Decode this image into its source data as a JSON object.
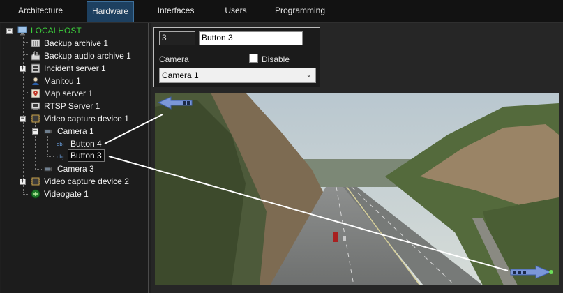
{
  "tabs": [
    {
      "label": "Architecture"
    },
    {
      "label": "Hardware"
    },
    {
      "label": "Interfaces"
    },
    {
      "label": "Users"
    },
    {
      "label": "Programming"
    }
  ],
  "active_tab": "Hardware",
  "tree": {
    "root": "LOCALHOST",
    "items": [
      {
        "label": "Backup archive 1",
        "icon": "backup-archive-icon"
      },
      {
        "label": "Backup audio archive 1",
        "icon": "audio-archive-icon"
      },
      {
        "label": "Incident server 1",
        "icon": "incident-server-icon"
      },
      {
        "label": "Manitou 1",
        "icon": "manitou-icon"
      },
      {
        "label": "Map server 1",
        "icon": "map-server-icon"
      },
      {
        "label": "RTSP Server 1",
        "icon": "rtsp-server-icon"
      },
      {
        "label": "Video capture device 1",
        "icon": "capture-device-icon"
      },
      {
        "label": "Camera 1",
        "icon": "camera-icon"
      },
      {
        "label": "Button 4",
        "icon": "obj-icon"
      },
      {
        "label": "Button 3",
        "icon": "obj-icon"
      },
      {
        "label": "Camera 3",
        "icon": "camera-icon"
      },
      {
        "label": "Video capture device 2",
        "icon": "capture-device-icon"
      },
      {
        "label": "Videogate 1",
        "icon": "videogate-icon"
      }
    ],
    "obj_badge": "obj"
  },
  "props": {
    "id_value": "3",
    "name_value": "Button 3",
    "camera_label": "Camera",
    "disable_label": "Disable",
    "camera_select": "Camera 1"
  },
  "colors": {
    "accent": "#1d4060",
    "root_green": "#3ccf3c",
    "arrow_blue": "#5b7fc8"
  }
}
